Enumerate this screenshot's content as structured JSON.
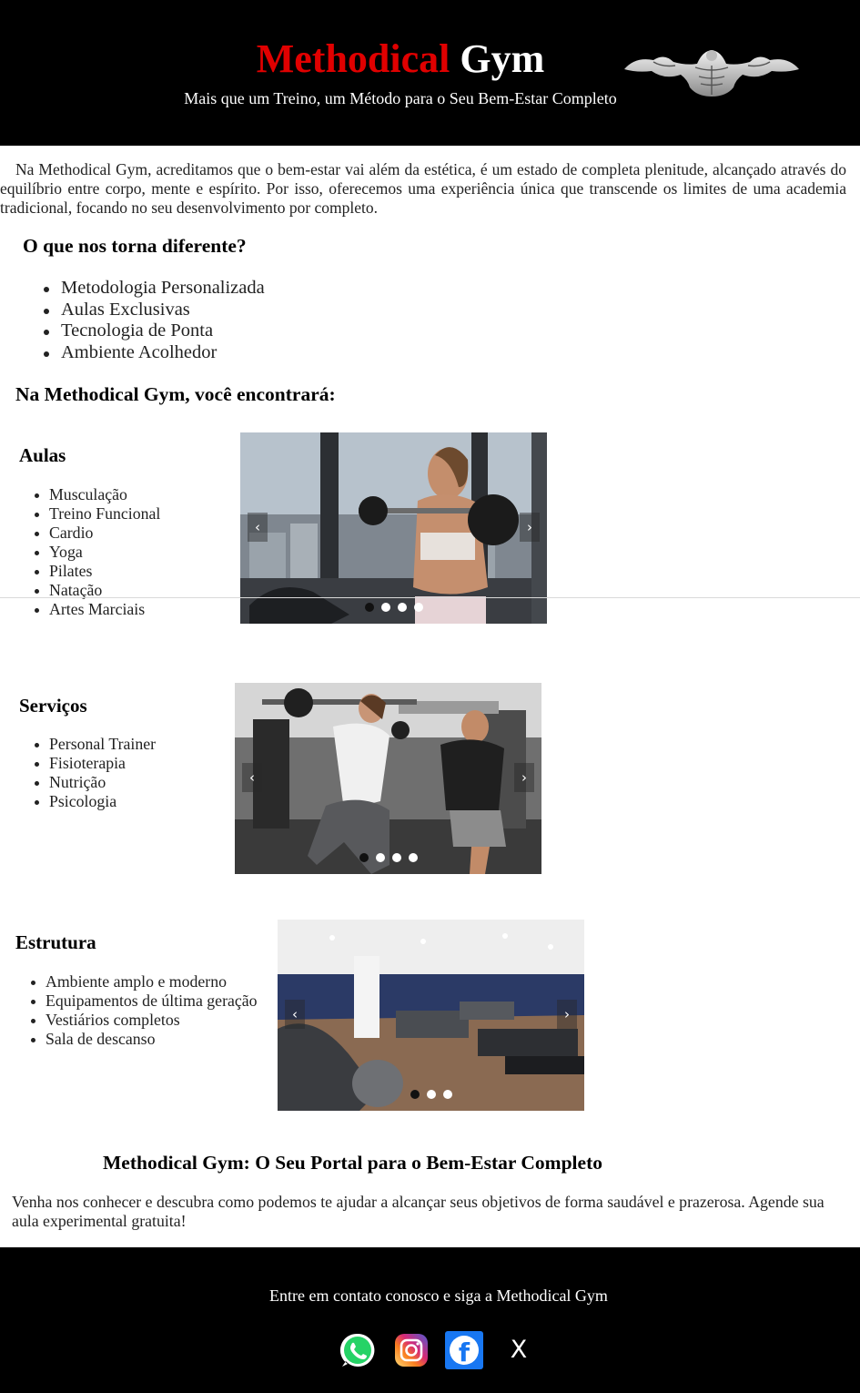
{
  "header": {
    "brand_part1": "Methodical",
    "brand_part2": "Gym",
    "tagline": "Mais que um Treino, um Método para o Seu Bem-Estar Completo"
  },
  "intro": "Na Methodical Gym, acreditamos que o bem-estar vai além da estética, é um estado de completa plenitude, alcançado através do equilíbrio entre corpo, mente e espírito. Por isso, oferecemos uma experiência única que transcende os limites de uma academia tradicional, focando no seu desenvolvimento por completo.",
  "differences": {
    "title": "O que nos torna diferente?",
    "items": [
      "Metodologia Personalizada",
      "Aulas Exclusivas",
      "Tecnologia de Ponta",
      "Ambiente Acolhedor"
    ]
  },
  "find_title": "Na Methodical Gym, você encontrará:",
  "sections": [
    {
      "title": "Aulas",
      "items": [
        "Musculação",
        "Treino Funcional",
        "Cardio",
        "Yoga",
        "Pilates",
        "Natação",
        "Artes Marciais"
      ],
      "carousel": {
        "prev": "‹",
        "next": "›",
        "slides": 4,
        "active": 0
      }
    },
    {
      "title": "Serviços",
      "items": [
        "Personal Trainer",
        "Fisioterapia",
        "Nutrição",
        "Psicologia"
      ],
      "carousel": {
        "prev": "‹",
        "next": "›",
        "slides": 4,
        "active": 0
      }
    },
    {
      "title": "Estrutura",
      "items": [
        "Ambiente amplo e moderno",
        "Equipamentos de última geração",
        "Vestiários completos",
        "Sala de descanso"
      ],
      "carousel": {
        "prev": "‹",
        "next": "›",
        "slides": 3,
        "active": 0
      }
    }
  ],
  "portal": {
    "title": "Methodical Gym: O Seu Portal para o Bem-Estar Completo",
    "text": "Venha nos conhecer e descubra como podemos te ajudar a alcançar seus objetivos de forma saudável e prazerosa. Agende sua aula experimental gratuita!"
  },
  "footer": {
    "text": "Entre em contato conosco e siga a Methodical Gym",
    "social": [
      "whatsapp-icon",
      "instagram-icon",
      "facebook-icon",
      "x-icon"
    ],
    "facebook_letter": "f",
    "x_letter": "X"
  },
  "colors": {
    "brand_red": "#e00000",
    "header_bg": "#000000",
    "facebook_blue": "#1877f2",
    "whatsapp_green": "#25d366"
  }
}
